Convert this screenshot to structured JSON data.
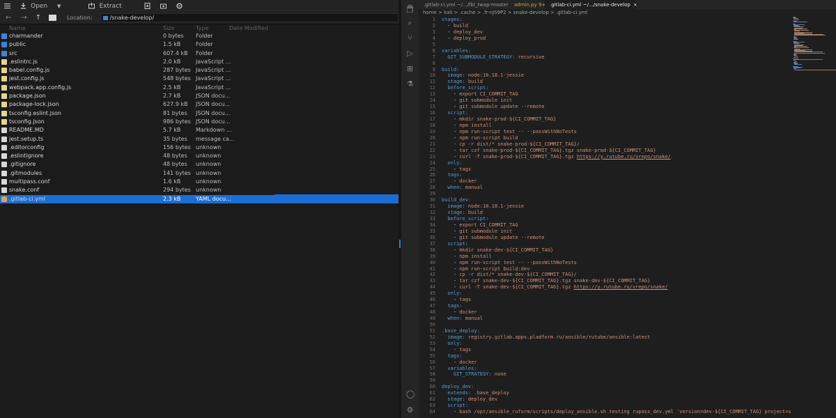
{
  "fm": {
    "toolbar": {
      "open": "Open",
      "extract": "Extract"
    },
    "location_label": "Location:",
    "location_value": "/snake-develop/",
    "columns": {
      "name": "Name",
      "size": "Size",
      "type": "Type",
      "modified": "Date Modified"
    },
    "rows": [
      {
        "name": "charmander",
        "size": "0 bytes",
        "type": "Folder",
        "icon": "folder"
      },
      {
        "name": "public",
        "size": "1.5 kB",
        "type": "Folder",
        "icon": "folder"
      },
      {
        "name": "src",
        "size": "607.4 kB",
        "type": "Folder",
        "icon": "folder"
      },
      {
        "name": ".eslintrc.js",
        "size": "2.0 kB",
        "type": "JavaScript ...",
        "icon": "doc"
      },
      {
        "name": "babel.config.js",
        "size": "287 bytes",
        "type": "JavaScript ...",
        "icon": "doc"
      },
      {
        "name": "jest.config.js",
        "size": "548 bytes",
        "type": "JavaScript ...",
        "icon": "doc"
      },
      {
        "name": "webpack.app.config.js",
        "size": "2.5 kB",
        "type": "JavaScript ...",
        "icon": "doc"
      },
      {
        "name": "package.json",
        "size": "2.7 kB",
        "type": "JSON docu...",
        "icon": "doc"
      },
      {
        "name": "package-lock.json",
        "size": "627.9 kB",
        "type": "JSON docu...",
        "icon": "doc"
      },
      {
        "name": "tsconfig.eslint.json",
        "size": "81 bytes",
        "type": "JSON docu...",
        "icon": "doc"
      },
      {
        "name": "tsconfig.json",
        "size": "986 bytes",
        "type": "JSON docu...",
        "icon": "doc"
      },
      {
        "name": "README.MD",
        "size": "5.7 kB",
        "type": "Markdown ...",
        "icon": "txt"
      },
      {
        "name": "jest.setup.ts",
        "size": "35 bytes",
        "type": "message ca...",
        "icon": "txt"
      },
      {
        "name": ".editorconfig",
        "size": "156 bytes",
        "type": "unknown",
        "icon": "txt"
      },
      {
        "name": ".eslintignore",
        "size": "48 bytes",
        "type": "unknown",
        "icon": "txt"
      },
      {
        "name": ".gitignore",
        "size": "48 bytes",
        "type": "unknown",
        "icon": "txt"
      },
      {
        "name": ".gitmodules",
        "size": "141 bytes",
        "type": "unknown",
        "icon": "txt"
      },
      {
        "name": "multipass.conf",
        "size": "1.6 kB",
        "type": "unknown",
        "icon": "txt"
      },
      {
        "name": "snake.conf",
        "size": "294 bytes",
        "type": "unknown",
        "icon": "txt"
      },
      {
        "name": ".gitlab-ci.yml",
        "size": "2.3 kB",
        "type": "YAML docu...",
        "icon": "yaml",
        "selected": true
      }
    ]
  },
  "editor": {
    "tabs": [
      {
        "label": ".gitlab-ci.yml ~/.../fbl_twap-master",
        "color": "#e0a24a"
      },
      {
        "label": "admin.py 9+",
        "color": "#d9b84a"
      },
      {
        "label": ".gitlab-ci.yml ~/.../snake-develop",
        "color": "#e0a24a",
        "active": true
      }
    ],
    "breadcrumb": "home > kali > .cache > .fr-nJS9P2 > snake-develop > .gitlab-ci.yml",
    "colors": {
      "key": "#569cd6",
      "value": "#ce9178",
      "selection": "#1c6ed4"
    },
    "lines": [
      [
        [
          "k",
          "stages:"
        ]
      ],
      [
        [
          "p",
          "  - "
        ],
        [
          "v",
          "build"
        ]
      ],
      [
        [
          "p",
          "  - "
        ],
        [
          "v",
          "deploy_dev"
        ]
      ],
      [
        [
          "p",
          "  - "
        ],
        [
          "v",
          "deploy_prod"
        ]
      ],
      [],
      [
        [
          "k",
          "variables:"
        ]
      ],
      [
        [
          "k",
          "  GIT_SUBMODULE_STRATEGY:"
        ],
        [
          "v",
          " recursive"
        ]
      ],
      [],
      [
        [
          "k",
          "build:"
        ]
      ],
      [
        [
          "k",
          "  image:"
        ],
        [
          "v",
          " node:10.18.1-jessie"
        ]
      ],
      [
        [
          "k",
          "  stage:"
        ],
        [
          "v",
          " build"
        ]
      ],
      [
        [
          "k",
          "  before_script:"
        ]
      ],
      [
        [
          "p",
          "    - "
        ],
        [
          "v",
          "export CI_COMMIT_TAG"
        ]
      ],
      [
        [
          "p",
          "    - "
        ],
        [
          "v",
          "git submodule init"
        ]
      ],
      [
        [
          "p",
          "    - "
        ],
        [
          "v",
          "git submodule update --remote"
        ]
      ],
      [
        [
          "k",
          "  script:"
        ]
      ],
      [
        [
          "p",
          "    - "
        ],
        [
          "v",
          "mkdir snake-prod-${CI_COMMIT_TAG}"
        ]
      ],
      [
        [
          "p",
          "    - "
        ],
        [
          "v",
          "npm install"
        ]
      ],
      [
        [
          "p",
          "    - "
        ],
        [
          "v",
          "npm run-script test -- --passWithNoTests"
        ]
      ],
      [
        [
          "p",
          "    - "
        ],
        [
          "v",
          "npm run-script build"
        ]
      ],
      [
        [
          "p",
          "    - "
        ],
        [
          "v",
          "cp -r dist/* snake-prod-${CI_COMMIT_TAG}/"
        ]
      ],
      [
        [
          "p",
          "    - "
        ],
        [
          "v",
          "tar czf snake-prod-${CI_COMMIT_TAG}.tgz snake-prod-${CI_COMMIT_TAG}"
        ]
      ],
      [
        [
          "p",
          "    - "
        ],
        [
          "v",
          "curl -T snake-prod-${CI_COMMIT_TAG}.tgz "
        ],
        [
          "u",
          "https://y.rutube.ru/vrepo/snake/"
        ]
      ],
      [
        [
          "k",
          "  only:"
        ]
      ],
      [
        [
          "p",
          "    - "
        ],
        [
          "v",
          "tags"
        ]
      ],
      [
        [
          "k",
          "  tags:"
        ]
      ],
      [
        [
          "p",
          "    - "
        ],
        [
          "v",
          "docker"
        ]
      ],
      [
        [
          "k",
          "  when:"
        ],
        [
          "v",
          " manual"
        ]
      ],
      [],
      [
        [
          "k",
          "build_dev:"
        ]
      ],
      [
        [
          "k",
          "  image:"
        ],
        [
          "v",
          " node:10.18.1-jessie"
        ]
      ],
      [
        [
          "k",
          "  stage:"
        ],
        [
          "v",
          " build"
        ]
      ],
      [
        [
          "k",
          "  before_script:"
        ]
      ],
      [
        [
          "p",
          "    - "
        ],
        [
          "v",
          "export CI_COMMIT_TAG"
        ]
      ],
      [
        [
          "p",
          "    - "
        ],
        [
          "v",
          "git submodule init"
        ]
      ],
      [
        [
          "p",
          "    - "
        ],
        [
          "v",
          "git submodule update --remote"
        ]
      ],
      [
        [
          "k",
          "  script:"
        ]
      ],
      [
        [
          "p",
          "    - "
        ],
        [
          "v",
          "mkdir snake-dev-${CI_COMMIT_TAG}"
        ]
      ],
      [
        [
          "p",
          "    - "
        ],
        [
          "v",
          "npm install"
        ]
      ],
      [
        [
          "p",
          "    - "
        ],
        [
          "v",
          "npm run-script test -- --passWithNoTests"
        ]
      ],
      [
        [
          "p",
          "    - "
        ],
        [
          "v",
          "npm run-script build:dev"
        ]
      ],
      [
        [
          "p",
          "    - "
        ],
        [
          "v",
          "cp -r dist/* snake-dev-${CI_COMMIT_TAG}/"
        ]
      ],
      [
        [
          "p",
          "    - "
        ],
        [
          "v",
          "tar czf snake-dev-${CI_COMMIT_TAG}.tgz snake-dev-${CI_COMMIT_TAG}"
        ]
      ],
      [
        [
          "p",
          "    - "
        ],
        [
          "v",
          "curl -T snake-dev-${CI_COMMIT_TAG}.tgz "
        ],
        [
          "u",
          "https://y.rutube.ru/vrepo/snake/"
        ]
      ],
      [
        [
          "k",
          "  only:"
        ]
      ],
      [
        [
          "p",
          "    - "
        ],
        [
          "v",
          "tags"
        ]
      ],
      [
        [
          "k",
          "  tags:"
        ]
      ],
      [
        [
          "p",
          "    - "
        ],
        [
          "v",
          "docker"
        ]
      ],
      [
        [
          "k",
          "  when:"
        ],
        [
          "v",
          " manual"
        ]
      ],
      [],
      [
        [
          "k",
          ".base_deploy:"
        ]
      ],
      [
        [
          "k",
          "  image:"
        ],
        [
          "v",
          " registry.gitlab.apps.pladform.ru/ansible/rutube/ansible:latest"
        ]
      ],
      [
        [
          "k",
          "  only:"
        ]
      ],
      [
        [
          "p",
          "    - "
        ],
        [
          "v",
          "tags"
        ]
      ],
      [
        [
          "k",
          "  tags:"
        ]
      ],
      [
        [
          "p",
          "    - "
        ],
        [
          "v",
          "docker"
        ]
      ],
      [
        [
          "k",
          "  variables:"
        ]
      ],
      [
        [
          "k",
          "    GIT_STRATEGY:"
        ],
        [
          "v",
          " none"
        ]
      ],
      [],
      [
        [
          "k",
          "deploy_dev:"
        ]
      ],
      [
        [
          "k",
          "  extends:"
        ],
        [
          "v",
          " .base_deploy"
        ]
      ],
      [
        [
          "k",
          "  stage:"
        ],
        [
          "v",
          " deploy_dev"
        ]
      ],
      [
        [
          "k",
          "  script:"
        ]
      ],
      [
        [
          "p",
          "    - "
        ],
        [
          "v",
          "bash /opt/ansible_ruform/scripts/deploy_ansible.sh testing rupass_dev.yml 'version=dev-${CI_COMMIT_TAG} project=snake_pro"
        ]
      ]
    ]
  }
}
